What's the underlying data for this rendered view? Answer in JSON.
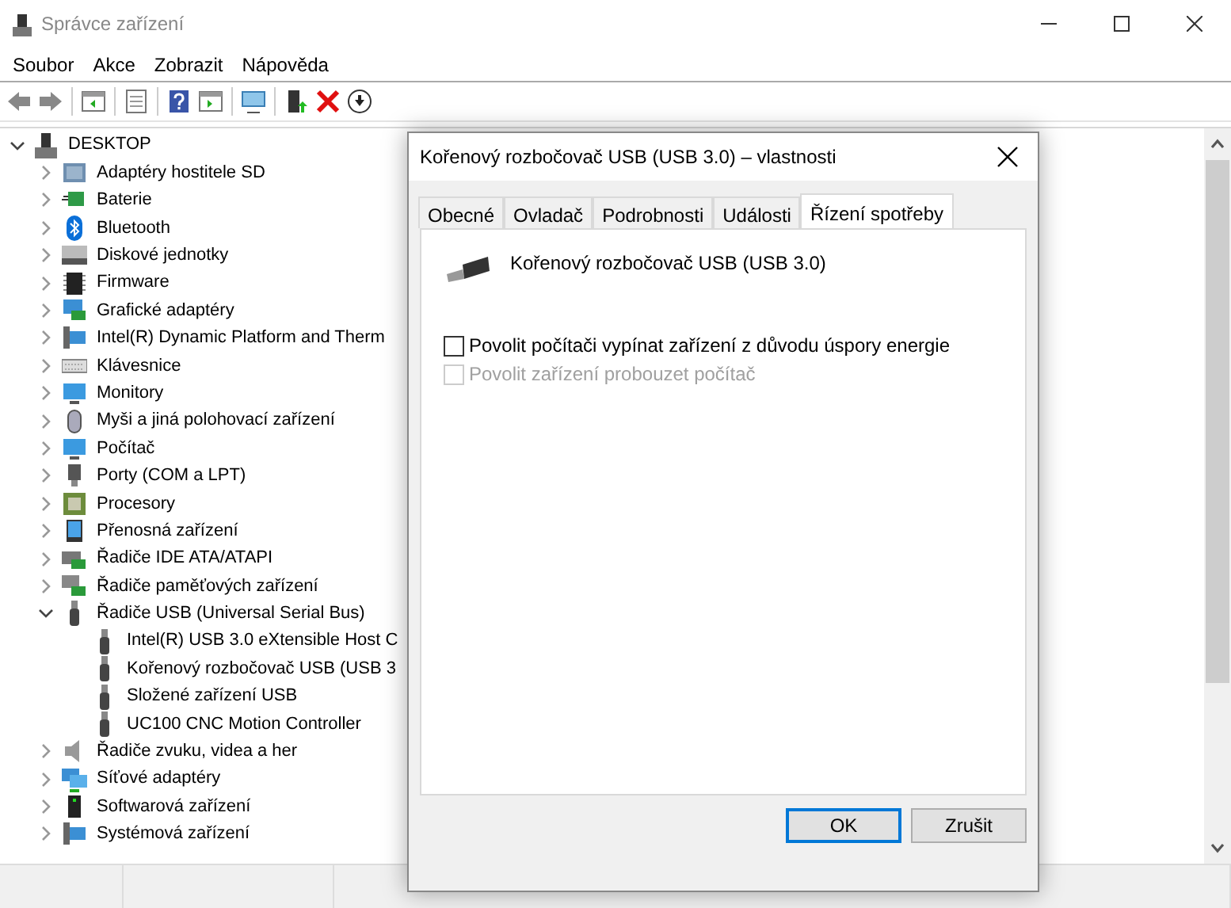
{
  "window": {
    "title": "Správce zařízení"
  },
  "menu": [
    "Soubor",
    "Akce",
    "Zobrazit",
    "Nápověda"
  ],
  "tree": {
    "label": "DESKTOP",
    "expanded": true,
    "children": [
      {
        "label": "Adaptéry hostitele SD",
        "expanded": false
      },
      {
        "label": "Baterie",
        "expanded": false
      },
      {
        "label": "Bluetooth",
        "expanded": false
      },
      {
        "label": "Diskové jednotky",
        "expanded": false
      },
      {
        "label": "Firmware",
        "expanded": false
      },
      {
        "label": "Grafické adaptéry",
        "expanded": false
      },
      {
        "label": "Intel(R) Dynamic Platform and Therm",
        "expanded": false
      },
      {
        "label": "Klávesnice",
        "expanded": false
      },
      {
        "label": "Monitory",
        "expanded": false
      },
      {
        "label": "Myši a jiná polohovací zařízení",
        "expanded": false
      },
      {
        "label": "Počítač",
        "expanded": false
      },
      {
        "label": "Porty (COM a LPT)",
        "expanded": false
      },
      {
        "label": "Procesory",
        "expanded": false
      },
      {
        "label": "Přenosná zařízení",
        "expanded": false
      },
      {
        "label": "Řadiče IDE ATA/ATAPI",
        "expanded": false
      },
      {
        "label": "Řadiče paměťových zařízení",
        "expanded": false
      },
      {
        "label": "Řadiče USB (Universal Serial Bus)",
        "expanded": true,
        "children": [
          {
            "label": "Intel(R) USB 3.0 eXtensible Host C"
          },
          {
            "label": "Kořenový rozbočovač USB (USB 3"
          },
          {
            "label": "Složené zařízení USB"
          },
          {
            "label": "UC100 CNC Motion Controller"
          }
        ]
      },
      {
        "label": "Řadiče zvuku, videa a her",
        "expanded": false
      },
      {
        "label": "Síťové adaptéry",
        "expanded": false
      },
      {
        "label": "Softwarová zařízení",
        "expanded": false
      },
      {
        "label": "Systémová zařízení",
        "expanded": false
      }
    ]
  },
  "dialog": {
    "title": "Kořenový rozbočovač USB (USB 3.0) – vlastnosti",
    "tabs": [
      {
        "label": "Obecné",
        "selected": false
      },
      {
        "label": "Ovladač",
        "selected": false
      },
      {
        "label": "Podrobnosti",
        "selected": false
      },
      {
        "label": "Události",
        "selected": false
      },
      {
        "label": "Řízení spotřeby",
        "selected": true
      }
    ],
    "device_name": "Kořenový rozbočovač USB (USB 3.0)",
    "options": [
      {
        "label": "Povolit počítači vypínat zařízení z důvodu úspory energie",
        "checked": false,
        "disabled": false
      },
      {
        "label": "Povolit zařízení probouzet počítač",
        "checked": false,
        "disabled": true
      }
    ],
    "buttons": [
      {
        "label": "OK",
        "default": true
      },
      {
        "label": "Zrušit",
        "default": false
      }
    ]
  }
}
